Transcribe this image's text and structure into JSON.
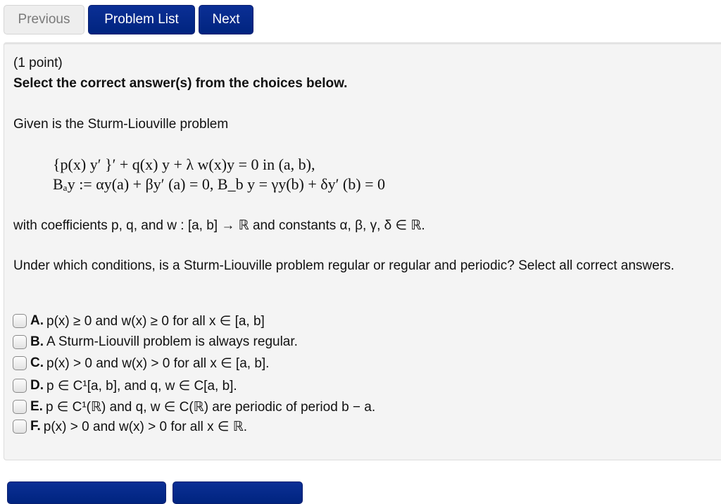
{
  "nav": {
    "previous": "Previous",
    "problem_list": "Problem List",
    "next": "Next"
  },
  "problem": {
    "points": "(1 point)",
    "instruction": "Select the correct answer(s) from the choices below.",
    "intro": "Given is the Sturm-Liouville problem",
    "equation_line1": "{p(x) y′ }′ + q(x) y + λ w(x)y = 0 in (a, b),",
    "equation_line2": "Bₐy := αy(a) + βy′ (a) = 0,  B_b y = γy(b) + δy′ (b) = 0",
    "coefficients_text": "with coefficients p, q, and w : [a, b] → ℝ and constants α, β, γ, δ ∈ ℝ.",
    "question": "Under which conditions, is a Sturm-Liouville problem regular or regular and periodic? Select all correct answers."
  },
  "choices": [
    {
      "letter": "A.",
      "text": "p(x) ≥ 0 and w(x) ≥ 0 for all x ∈ [a, b]",
      "checked": false
    },
    {
      "letter": "B.",
      "text": "A Sturm-Liouvill problem is always regular.",
      "checked": false
    },
    {
      "letter": "C.",
      "text": "p(x) > 0 and w(x) > 0 for all x ∈ [a, b].",
      "checked": false
    },
    {
      "letter": "D.",
      "text": "p ∈ C¹[a, b], and q, w ∈ C[a, b].",
      "checked": false
    },
    {
      "letter": "E.",
      "text": "p ∈ C¹(ℝ) and q, w ∈ C(ℝ) are periodic of period b − a.",
      "checked": false
    },
    {
      "letter": "F.",
      "text": "p(x) > 0 and w(x) > 0 for all x ∈ ℝ.",
      "checked": false
    }
  ]
}
